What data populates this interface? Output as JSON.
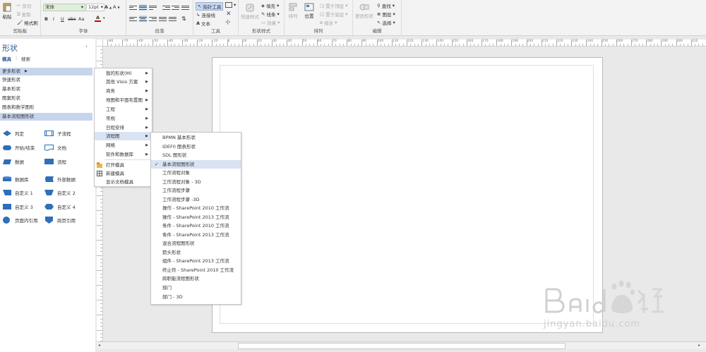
{
  "ribbon": {
    "clipboard": {
      "paste": "粘贴",
      "cut": "剪切",
      "copy": "复制",
      "format_painter": "格式刷",
      "label": "剪贴板"
    },
    "font": {
      "name": "宋体",
      "size": "12pt",
      "bold": "B",
      "italic": "I",
      "underline": "U",
      "strike": "abc",
      "case": "Aa",
      "color_a": "A",
      "grow": "A",
      "shrink": "A",
      "label": "字体"
    },
    "paragraph": {
      "label": "段落"
    },
    "tools": {
      "pointer": "指针工具",
      "connector": "连接线",
      "text": "文本",
      "label": "工具"
    },
    "shape_styles": {
      "quick_styles": "快速样式",
      "fill": "填充",
      "line": "线条",
      "effects": "效果",
      "label": "形状样式"
    },
    "arrange": {
      "align": "排列",
      "position": "位置",
      "bring_front": "置于顶层",
      "send_back": "置于底层",
      "group": "组合",
      "label": "排列"
    },
    "editing": {
      "change_shape": "更改形状",
      "find": "查找",
      "layers": "图层",
      "select": "选择",
      "label": "编辑"
    }
  },
  "pane": {
    "title": "形状",
    "tabs": [
      "模具",
      "搜索"
    ],
    "stencils": [
      "更多形状",
      "快速形状",
      "基本形状",
      "图案形状",
      "图表和数学图形",
      "基本流程图形状"
    ],
    "shapes": [
      {
        "icon": "diamond-icon",
        "label": "判定"
      },
      {
        "icon": "subprocess-icon",
        "label": "子流程"
      },
      {
        "icon": "terminator-icon",
        "label": "开始/结束"
      },
      {
        "icon": "document-icon",
        "label": "文档"
      },
      {
        "icon": "data-icon",
        "label": "数据"
      },
      {
        "icon": "process-icon",
        "label": "流程"
      },
      {
        "icon": "database-icon",
        "label": "数据库"
      },
      {
        "icon": "external-data-icon",
        "label": "外部数据"
      },
      {
        "icon": "custom1-icon",
        "label": "自定义 1"
      },
      {
        "icon": "custom2-icon",
        "label": "自定义 2"
      },
      {
        "icon": "custom3-icon",
        "label": "自定义 3"
      },
      {
        "icon": "custom4-icon",
        "label": "自定义 4"
      },
      {
        "icon": "on-page-ref-icon",
        "label": "页面内引用"
      },
      {
        "icon": "off-page-ref-icon",
        "label": "跨页引用"
      }
    ]
  },
  "menu1": {
    "items": [
      "我的形状(M)",
      "其他 Visio 方案",
      "商务",
      "地图和平面布置图",
      "工程",
      "常规",
      "日程安排",
      "流程图",
      "网络",
      "软件和数据库"
    ],
    "actions": [
      "打开模具",
      "新建模具",
      "显示文档模具"
    ]
  },
  "menu2": {
    "items": [
      "BPMN 基本形状",
      "IDEF0 图表形状",
      "SDL 图形状",
      "基本流程图形状",
      "工作流程对象",
      "工作流程对象 - 3D",
      "工作流程步骤",
      "工作流程步骤 -3D",
      "操作 - SharePoint 2010 工作流",
      "操作 - SharePoint 2013 工作流",
      "条件 - SharePoint 2010 工作流",
      "条件 - SharePoint 2013 工作流",
      "混合流程图形状",
      "箭头形状",
      "组件 - SharePoint 2013 工作流",
      "终止符 - SharePoint 2010 工作流",
      "跨职能流程图形状",
      "部门",
      "部门 - 3D"
    ],
    "checked": "✓"
  },
  "ruler": {
    "h_ticks": [
      "-80",
      "-70",
      "-60",
      "-50",
      "-40",
      "-30",
      "-20",
      "-10",
      "0",
      "10",
      "20",
      "30",
      "40",
      "50",
      "60",
      "70",
      "80",
      "90",
      "100",
      "110",
      "120",
      "130",
      "140",
      "150",
      "160",
      "170",
      "180",
      "190",
      "200",
      "210",
      "220",
      "230",
      "240",
      "250",
      "260",
      "270",
      "280",
      "290",
      "300",
      "310"
    ]
  },
  "watermark": {
    "brand": "Baidu 经验",
    "url": "jingyan.baidu.com"
  },
  "colors": {
    "accent": "#2b579a",
    "shape_blue": "#2e6fb8",
    "highlight": "#d9e3f3",
    "stencil_active": "#c7d5ec"
  }
}
